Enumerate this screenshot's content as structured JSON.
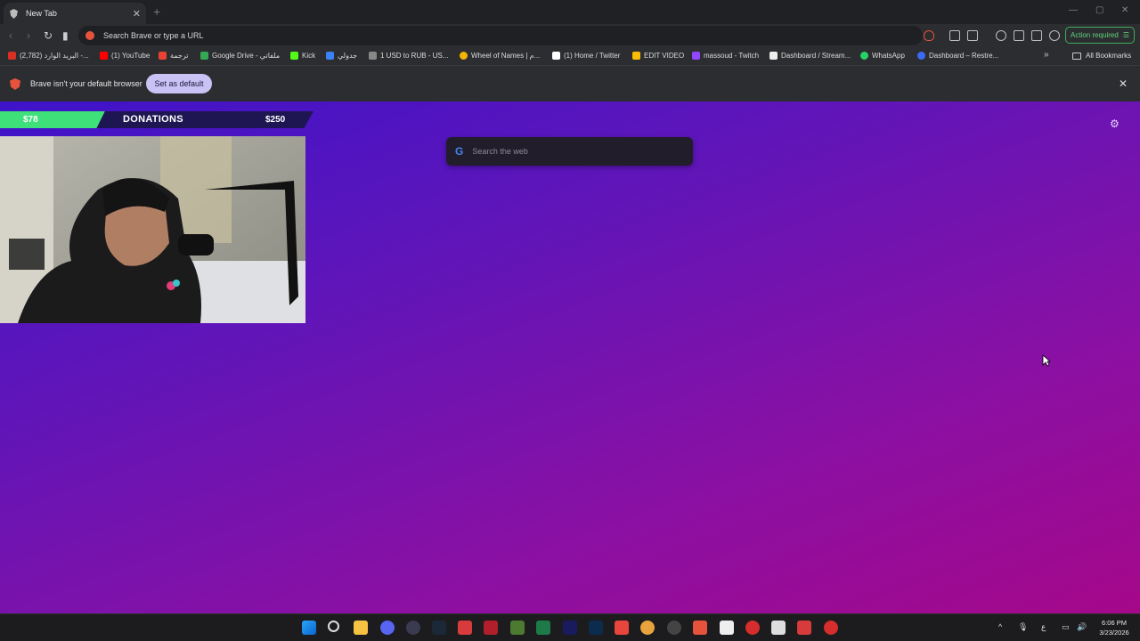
{
  "browser": {
    "tab": {
      "title": "New Tab"
    },
    "url_placeholder": "Search Brave or type a URL",
    "action_required": "Action required",
    "bookmarks": [
      {
        "label": "(2,782) البريد الوارد -...",
        "color": "#d93025"
      },
      {
        "label": "(1) YouTube",
        "color": "#ff0000"
      },
      {
        "label": "ترجمة",
        "color": "#e94235"
      },
      {
        "label": "Google Drive - ملفاتي",
        "color": "#34a853"
      },
      {
        "label": "Kick",
        "color": "#53fc18"
      },
      {
        "label": "جدولي",
        "color": "#3b82f6"
      },
      {
        "label": "1 USD to RUB - US...",
        "color": "#888888"
      },
      {
        "label": "Wheel of Names | م...",
        "color": "#f4b400"
      },
      {
        "label": "(1) Home / Twitter",
        "color": "#ffffff"
      },
      {
        "label": "EDIT VIDEO",
        "color": "#fbbc04"
      },
      {
        "label": "massoud - Twitch",
        "color": "#9146ff"
      },
      {
        "label": "Dashboard / Stream...",
        "color": "#eeeeee"
      },
      {
        "label": "WhatsApp",
        "color": "#25d366"
      },
      {
        "label": "Dashboard – Restre...",
        "color": "#3b6bf6"
      }
    ],
    "all_bookmarks": "All Bookmarks",
    "infobar": {
      "message": "Brave isn't your default browser",
      "button": "Set as default"
    }
  },
  "newtab": {
    "search_placeholder": "Search the web",
    "donations": {
      "current": "$78",
      "title": "DONATIONS",
      "goal": "$250",
      "progress": 0.312
    }
  },
  "taskbar": {
    "time": "6:06 PM",
    "date": "3/23/2026",
    "lang": "ع"
  }
}
